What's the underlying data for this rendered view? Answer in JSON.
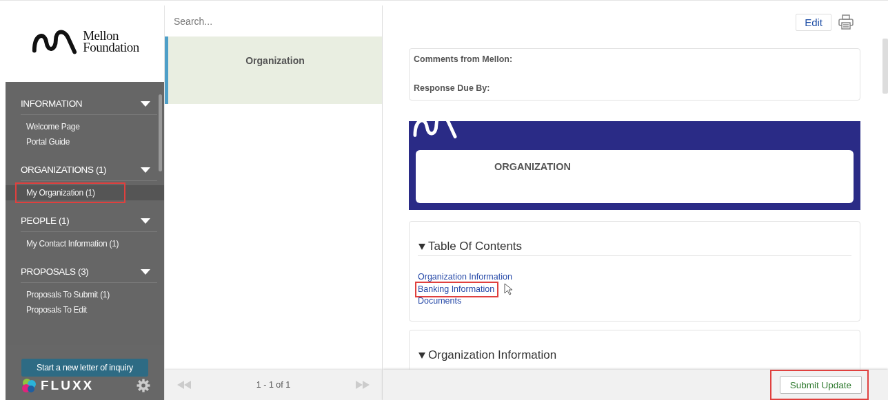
{
  "logo": {
    "line_1": "Mellon",
    "line_2": "Foundation"
  },
  "sidebar": {
    "sections": [
      {
        "title": "INFORMATION",
        "expanded": true,
        "items": [
          {
            "label": "Welcome Page",
            "selected": false,
            "highlighted": false
          },
          {
            "label": "Portal Guide",
            "selected": false,
            "highlighted": false
          }
        ]
      },
      {
        "title": "ORGANIZATIONS (1)",
        "expanded": true,
        "items": [
          {
            "label": "My Organization  (1)",
            "selected": true,
            "highlighted": true
          }
        ]
      },
      {
        "title": "PEOPLE (1)",
        "expanded": true,
        "items": [
          {
            "label": "My Contact Information  (1)",
            "selected": false,
            "highlighted": false
          }
        ]
      },
      {
        "title": "PROPOSALS (3)",
        "expanded": true,
        "items": [
          {
            "label": "Proposals To Submit  (1)",
            "selected": false,
            "highlighted": false
          },
          {
            "label": "Proposals To Edit",
            "selected": false,
            "highlighted": false
          }
        ]
      }
    ],
    "new_button": "Start a new letter of inquiry",
    "brand": "FLUXX"
  },
  "list": {
    "search": {
      "placeholder": "Search..."
    },
    "cards": [
      {
        "title": "Organization",
        "selected": true
      }
    ],
    "pager": "1 - 1 of 1"
  },
  "detail": {
    "edit_button": "Edit",
    "comments_label": "Comments from Mellon:",
    "response_label": "Response Due By:",
    "banner_title": "ORGANIZATION",
    "toc": {
      "title": "Table Of Contents",
      "expanded": true,
      "links": [
        {
          "label": "Organization Information",
          "highlighted": false
        },
        {
          "label": "Banking Information",
          "highlighted": true
        },
        {
          "label": "Documents",
          "highlighted": false
        }
      ]
    },
    "section": {
      "title": "Organization Information",
      "expanded": true
    },
    "submit_button": {
      "label": "Submit Update",
      "highlighted": true
    }
  }
}
